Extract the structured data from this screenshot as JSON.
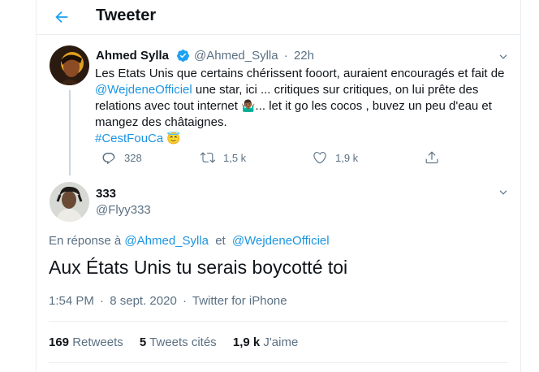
{
  "header": {
    "title": "Tweeter"
  },
  "parent_tweet": {
    "author_name": "Ahmed Sylla",
    "author_handle": "@Ahmed_Sylla",
    "separator": "·",
    "time": "22h",
    "text_part1": "Les Etats Unis que certains chérissent fooort, auraient encouragés et fait de ",
    "mention": "@WejdeneOfficiel",
    "text_part2": " une star, ici ... critiques sur critiques, on lui prête des relations avec tout internet ",
    "emoji_1": "🤷🏾‍♂️",
    "text_part3": "... let it go les cocos , buvez un peu d'eau et mangez des châtaignes.",
    "hashtag": "#CestFouCa",
    "emoji_2": "😇",
    "actions": {
      "reply_count": "328",
      "retweet_count": "1,5 k",
      "like_count": "1,9 k"
    }
  },
  "main_tweet": {
    "author_name": "333",
    "author_handle": "@Flyy333",
    "reply_prefix": "En réponse à",
    "reply_to_1": "@Ahmed_Sylla",
    "reply_and": "et",
    "reply_to_2": "@WejdeneOfficiel",
    "text": "Aux États Unis tu serais boycotté toi",
    "time": "1:54 PM",
    "separator": "·",
    "date": "8 sept. 2020",
    "separator2": "·",
    "source": "Twitter for iPhone",
    "stats": {
      "retweets_value": "169",
      "retweets_label": "Retweets",
      "quotes_value": "5",
      "quotes_label": "Tweets cités",
      "likes_value": "1,9 k",
      "likes_label": "J'aime"
    }
  },
  "colors": {
    "accent": "#1da1f2",
    "link": "#1b95e0",
    "muted": "#5b7083",
    "border": "#ebeef0"
  }
}
